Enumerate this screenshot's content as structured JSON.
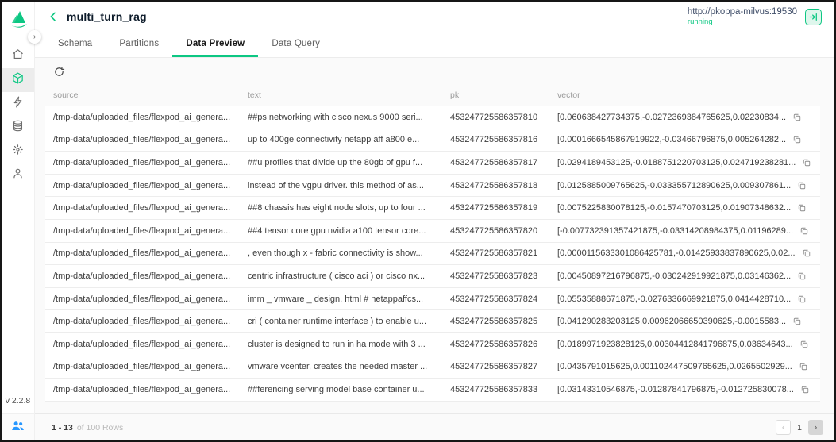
{
  "colors": {
    "accent": "#0dc783",
    "blue": "#2797ff"
  },
  "sidebar": {
    "logo": "attu-logo",
    "items": [
      {
        "id": "home",
        "icon": "home-icon",
        "active": false
      },
      {
        "id": "database",
        "icon": "cube-icon",
        "active": true
      },
      {
        "id": "search",
        "icon": "lightning-icon",
        "active": false
      },
      {
        "id": "data",
        "icon": "database-stack-icon",
        "active": false
      },
      {
        "id": "system",
        "icon": "system-burst-icon",
        "active": false
      },
      {
        "id": "user",
        "icon": "user-icon",
        "active": false
      }
    ],
    "version": "v 2.2.8"
  },
  "header": {
    "title": "multi_turn_rag",
    "connection": {
      "url": "http://pkoppa-milvus:19530",
      "status": "running"
    }
  },
  "tabs": [
    {
      "label": "Schema",
      "active": false
    },
    {
      "label": "Partitions",
      "active": false
    },
    {
      "label": "Data Preview",
      "active": true
    },
    {
      "label": "Data Query",
      "active": false
    }
  ],
  "table": {
    "columns": [
      "source",
      "text",
      "pk",
      "vector"
    ],
    "rows": [
      {
        "source": "/tmp-data/uploaded_files/flexpod_ai_genera...",
        "text": "##ps networking with cisco nexus 9000 seri...",
        "pk": "453247725586357810",
        "vector": "[0.060638427734375,-0.0272369384765625,0.02230834..."
      },
      {
        "source": "/tmp-data/uploaded_files/flexpod_ai_genera...",
        "text": "up to 400ge connectivity netapp aff a800 e...",
        "pk": "453247725586357816",
        "vector": "[0.0001666545867919922,-0.03466796875,0.005264282..."
      },
      {
        "source": "/tmp-data/uploaded_files/flexpod_ai_genera...",
        "text": "##u profiles that divide up the 80gb of gpu f...",
        "pk": "453247725586357817",
        "vector": "[0.0294189453125,-0.0188751220703125,0.024719238281..."
      },
      {
        "source": "/tmp-data/uploaded_files/flexpod_ai_genera...",
        "text": "instead of the vgpu driver. this method of as...",
        "pk": "453247725586357818",
        "vector": "[0.0125885009765625,-0.033355712890625,0.009307861..."
      },
      {
        "source": "/tmp-data/uploaded_files/flexpod_ai_genera...",
        "text": "##8 chassis has eight node slots, up to four ...",
        "pk": "453247725586357819",
        "vector": "[0.0075225830078125,-0.0157470703125,0.01907348632..."
      },
      {
        "source": "/tmp-data/uploaded_files/flexpod_ai_genera...",
        "text": "##4 tensor core gpu nvidia a100 tensor core...",
        "pk": "453247725586357820",
        "vector": "[-0.007732391357421875,-0.03314208984375,0.01196289..."
      },
      {
        "source": "/tmp-data/uploaded_files/flexpod_ai_genera...",
        "text": ", even though x - fabric connectivity is show...",
        "pk": "453247725586357821",
        "vector": "[0.0000115633301086425781,-0.01425933837890625,0.02..."
      },
      {
        "source": "/tmp-data/uploaded_files/flexpod_ai_genera...",
        "text": "centric infrastructure ( cisco aci ) or cisco nx...",
        "pk": "453247725586357823",
        "vector": "[0.00450897216796875,-0.030242919921875,0.03146362..."
      },
      {
        "source": "/tmp-data/uploaded_files/flexpod_ai_genera...",
        "text": "imm _ vmware _ design. html # netappaffcs...",
        "pk": "453247725586357824",
        "vector": "[0.05535888671875,-0.0276336669921875,0.0414428710..."
      },
      {
        "source": "/tmp-data/uploaded_files/flexpod_ai_genera...",
        "text": "cri ( container runtime interface ) to enable u...",
        "pk": "453247725586357825",
        "vector": "[0.041290283203125,0.00962066650390625,-0.0015583..."
      },
      {
        "source": "/tmp-data/uploaded_files/flexpod_ai_genera...",
        "text": "cluster is designed to run in ha mode with 3 ...",
        "pk": "453247725586357826",
        "vector": "[0.0189971923828125,0.00304412841796875,0.03634643..."
      },
      {
        "source": "/tmp-data/uploaded_files/flexpod_ai_genera...",
        "text": "vmware vcenter, creates the needed master ...",
        "pk": "453247725586357827",
        "vector": "[0.0435791015625,0.001102447509765625,0.0265502929..."
      },
      {
        "source": "/tmp-data/uploaded_files/flexpod_ai_genera...",
        "text": "##ferencing serving model base container u...",
        "pk": "453247725586357833",
        "vector": "[0.03143310546875,-0.01287841796875,-0.012725830078..."
      }
    ]
  },
  "footer": {
    "range": "1 - 13",
    "total": "of 100 Rows",
    "page": "1",
    "prev": "‹",
    "next": "›"
  },
  "toggle": {
    "collapse": "›"
  }
}
